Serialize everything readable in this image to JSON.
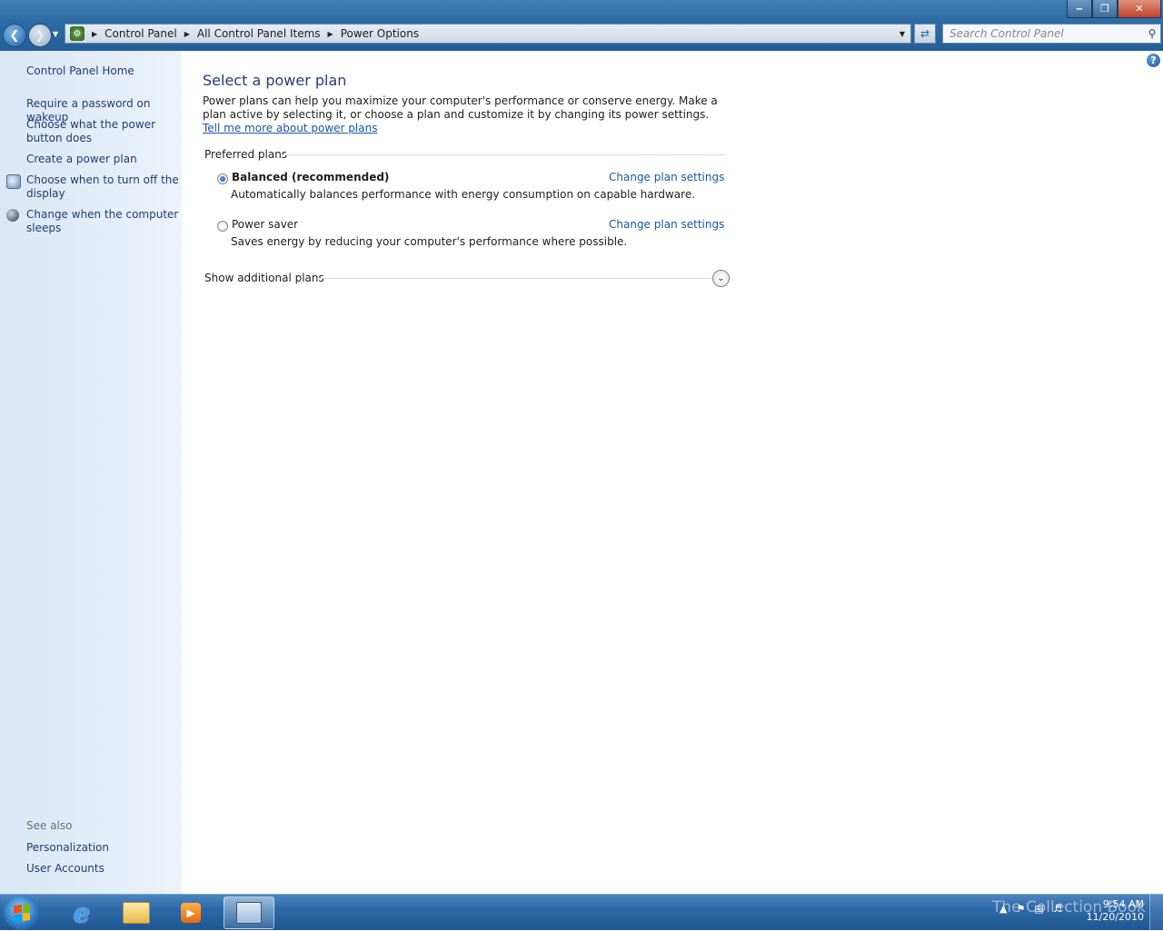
{
  "window": {
    "minimize_label": "‒",
    "maximize_label": "❐",
    "close_label": "✕"
  },
  "addressbar": {
    "breadcrumbs": [
      "Control Panel",
      "All Control Panel Items",
      "Power Options"
    ]
  },
  "search": {
    "placeholder": "Search Control Panel"
  },
  "leftnav": {
    "home": "Control Panel Home",
    "items": [
      "Require a password on wakeup",
      "Choose what the power button does",
      "Create a power plan",
      "Choose when to turn off the display",
      "Change when the computer sleeps"
    ],
    "see_also_label": "See also",
    "see_also": [
      "Personalization",
      "User Accounts"
    ]
  },
  "main": {
    "title": "Select a power plan",
    "intro": "Power plans can help you maximize your computer's performance or conserve energy. Make a plan active by selecting it, or choose a plan and customize it by changing its power settings.",
    "intro_link": "Tell me more about power plans",
    "preferred_label": "Preferred plans",
    "plans": [
      {
        "name": "Balanced (recommended)",
        "desc": "Automatically balances performance with energy consumption on capable hardware.",
        "link": "Change plan settings",
        "selected": true
      },
      {
        "name": "Power saver",
        "desc": "Saves energy by reducing your computer's performance where possible.",
        "link": "Change plan settings",
        "selected": false
      }
    ],
    "additional_label": "Show additional plans"
  },
  "taskbar": {
    "watermark": "The Collection Book",
    "time": "9:54 AM",
    "date": "11/20/2010"
  },
  "colors": {
    "link": "#1a56a8",
    "title": "#1e3f75",
    "nav_bg": "#dbe7f5"
  }
}
